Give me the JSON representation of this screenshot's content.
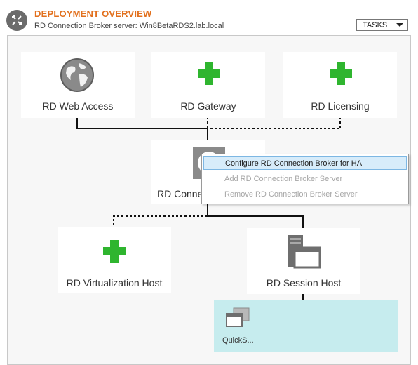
{
  "header": {
    "title": "DEPLOYMENT OVERVIEW",
    "subtitle": "RD Connection Broker server: Win8BetaRDS2.lab.local",
    "tasks_label": "TASKS"
  },
  "roles": {
    "web_access": {
      "label": "RD Web Access",
      "icon": "globe-icon"
    },
    "gateway": {
      "label": "RD Gateway",
      "icon": "green-plus-icon"
    },
    "licensing": {
      "label": "RD Licensing",
      "icon": "green-plus-icon"
    },
    "connection_broker": {
      "label": "RD Conne",
      "icon": "gear-icon"
    },
    "virtualization_host": {
      "label": "RD Virtualization Host",
      "icon": "green-plus-icon"
    },
    "session_host": {
      "label": "RD Session Host",
      "icon": "server-icon"
    }
  },
  "collection": {
    "label": "QuickS...",
    "icon": "windows-stack-icon"
  },
  "context_menu": {
    "items": [
      {
        "label": "Configure RD Connection Broker for HA",
        "state": "active"
      },
      {
        "label": "Add RD Connection Broker Server",
        "state": "disabled"
      },
      {
        "label": "Remove RD Connection Broker Server",
        "state": "disabled"
      }
    ]
  },
  "colors": {
    "title": "#e2701d",
    "plus_green": "#2fb52f",
    "collection_bg": "#c6ecee",
    "menu_highlight": "#d7ecfa"
  }
}
